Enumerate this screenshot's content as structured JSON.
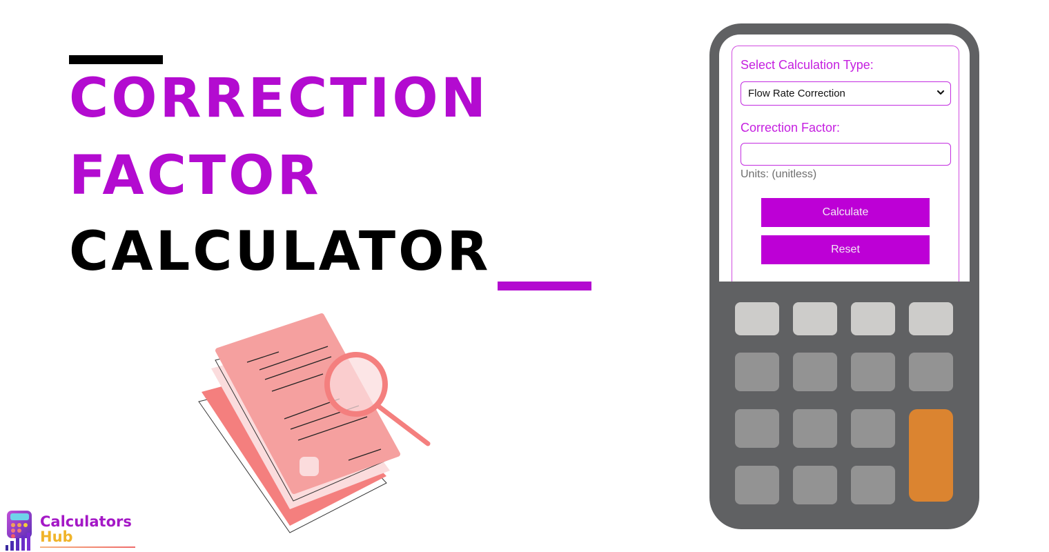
{
  "title": {
    "line1": "Correction",
    "line2": "Factor",
    "line3": "Calculator",
    "accent_color": "#b30bd0",
    "text_color": "#000000"
  },
  "illustration": {
    "description": "documents-with-magnifying-glass",
    "colors": {
      "page_front": "#f5a09f",
      "page_back": "#f47f7e",
      "page_light": "#fbdcdd",
      "magnifier": "#f47f7e"
    }
  },
  "logo": {
    "name_line1": "Calculators",
    "name_line2": "Hub"
  },
  "calculator": {
    "calc_type_label": "Select Calculation Type:",
    "calc_type_selected": "Flow Rate Correction",
    "correction_factor_label": "Correction Factor:",
    "correction_factor_value": "",
    "correction_factor_placeholder": "",
    "units_text": "Units: (unitless)",
    "calculate_label": "Calculate",
    "reset_label": "Reset",
    "accent_color": "#bd00d6",
    "body_color": "#606163",
    "keypad": {
      "rows": [
        [
          "light",
          "light",
          "light",
          "light"
        ],
        [
          "dark",
          "dark",
          "dark",
          "dark"
        ],
        [
          "dark",
          "dark",
          "dark",
          "orange"
        ],
        [
          "dark",
          "dark",
          "dark"
        ]
      ],
      "colors": {
        "light": "#cdccca",
        "dark": "#939393",
        "orange": "#db8430"
      }
    }
  }
}
